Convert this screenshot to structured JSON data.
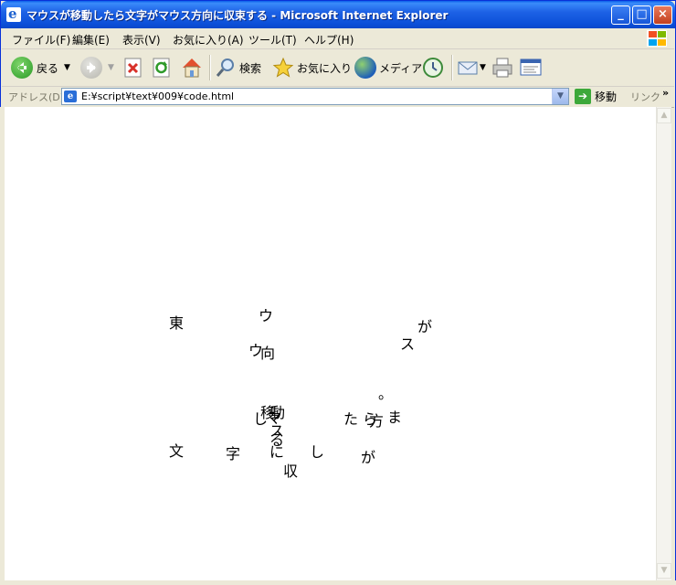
{
  "window": {
    "title": "マウスが移動したら文字がマウス方向に収束する - Microsoft Internet Explorer",
    "minimize": "_",
    "maximize": "□",
    "close": "×"
  },
  "menu": {
    "items": [
      "ファイル(F)",
      "編集(E)",
      "表示(V)",
      "お気に入り(A)",
      "ツール(T)",
      "ヘルプ(H)"
    ]
  },
  "toolbar": {
    "back_label": "戻る",
    "search_label": "検索",
    "favorites_label": "お気に入り",
    "media_label": "メディア"
  },
  "address": {
    "label": "アドレス(D)",
    "value": "E:¥script¥text¥009¥code.html",
    "go_label": "移動",
    "links_label": "リンク",
    "more": "»"
  },
  "colors": {
    "titlebar": "#0B4FD8",
    "chrome": "#ECE9D8",
    "content": "#FFFFFF",
    "text": "#000000"
  },
  "content": {
    "characters": [
      {
        "char": "東"
      },
      {
        "char": "ウ"
      },
      {
        "char": "が"
      },
      {
        "char": "ス"
      },
      {
        "char": "ウ"
      },
      {
        "char": "向"
      },
      {
        "char": "。"
      },
      {
        "char": "移"
      },
      {
        "char": "動"
      },
      {
        "char": "し"
      },
      {
        "char": "マ"
      },
      {
        "char": "た"
      },
      {
        "char": "ら"
      },
      {
        "char": "方"
      },
      {
        "char": "ま"
      },
      {
        "char": "ス"
      },
      {
        "char": "る"
      },
      {
        "char": "文"
      },
      {
        "char": "字"
      },
      {
        "char": "に"
      },
      {
        "char": "し"
      },
      {
        "char": "が"
      },
      {
        "char": "収"
      }
    ]
  }
}
